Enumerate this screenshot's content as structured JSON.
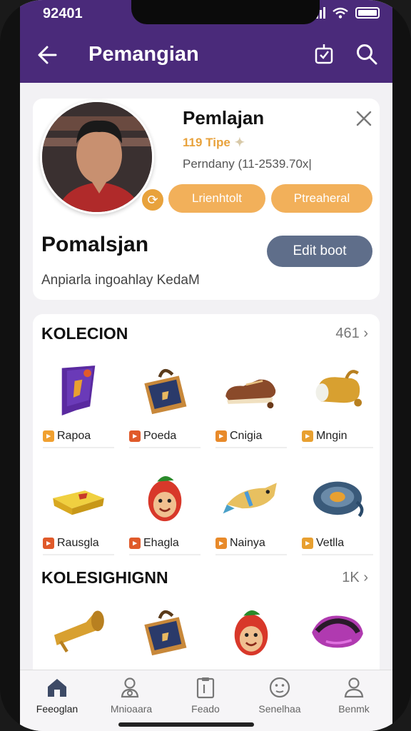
{
  "status": {
    "time": "92401"
  },
  "appbar": {
    "title": "Pemangian"
  },
  "profile": {
    "name": "Pemlajan",
    "type": "119 Tipe",
    "company": "Perndany (11-2539.70x|",
    "chips": [
      "Lrienhtolt",
      "Ptreaheral"
    ],
    "display_name": "Pomalsjan",
    "edit_label": "Edit boot",
    "bio": "Anpiarla ingoahlay KedaM"
  },
  "collection1": {
    "title": "KOLECION",
    "count": "461",
    "items": [
      {
        "label": "Rapoa",
        "icon": "banner-icon",
        "tag_color": "#f0a030"
      },
      {
        "label": "Poeda",
        "icon": "bag-icon",
        "tag_color": "#e05a2a"
      },
      {
        "label": "Cnigia",
        "icon": "shoe-icon",
        "tag_color": "#e88a2a"
      },
      {
        "label": "Mngin",
        "icon": "bell-icon",
        "tag_color": "#e8a030"
      },
      {
        "label": "Rausgla",
        "icon": "chest-icon",
        "tag_color": "#e05a2a"
      },
      {
        "label": "Ehagla",
        "icon": "mascot-icon",
        "tag_color": "#e05a2a"
      },
      {
        "label": "Nainya",
        "icon": "fish-icon",
        "tag_color": "#e88a2a"
      },
      {
        "label": "Vetlla",
        "icon": "disc-icon",
        "tag_color": "#e8a030"
      }
    ]
  },
  "collection2": {
    "title": "KOLESIGHIGNN",
    "count": "1K",
    "items": [
      {
        "icon": "horn-icon"
      },
      {
        "icon": "bag-icon"
      },
      {
        "icon": "mascot-icon"
      },
      {
        "icon": "shell-icon"
      }
    ]
  },
  "tabs": [
    {
      "label": "Feeoglan",
      "icon": "home-icon"
    },
    {
      "label": "Mnioaara",
      "icon": "user-search-icon"
    },
    {
      "label": "Feado",
      "icon": "clipboard-icon"
    },
    {
      "label": "Senelhaa",
      "icon": "smile-icon"
    },
    {
      "label": "Benmk",
      "icon": "profile-icon"
    }
  ]
}
